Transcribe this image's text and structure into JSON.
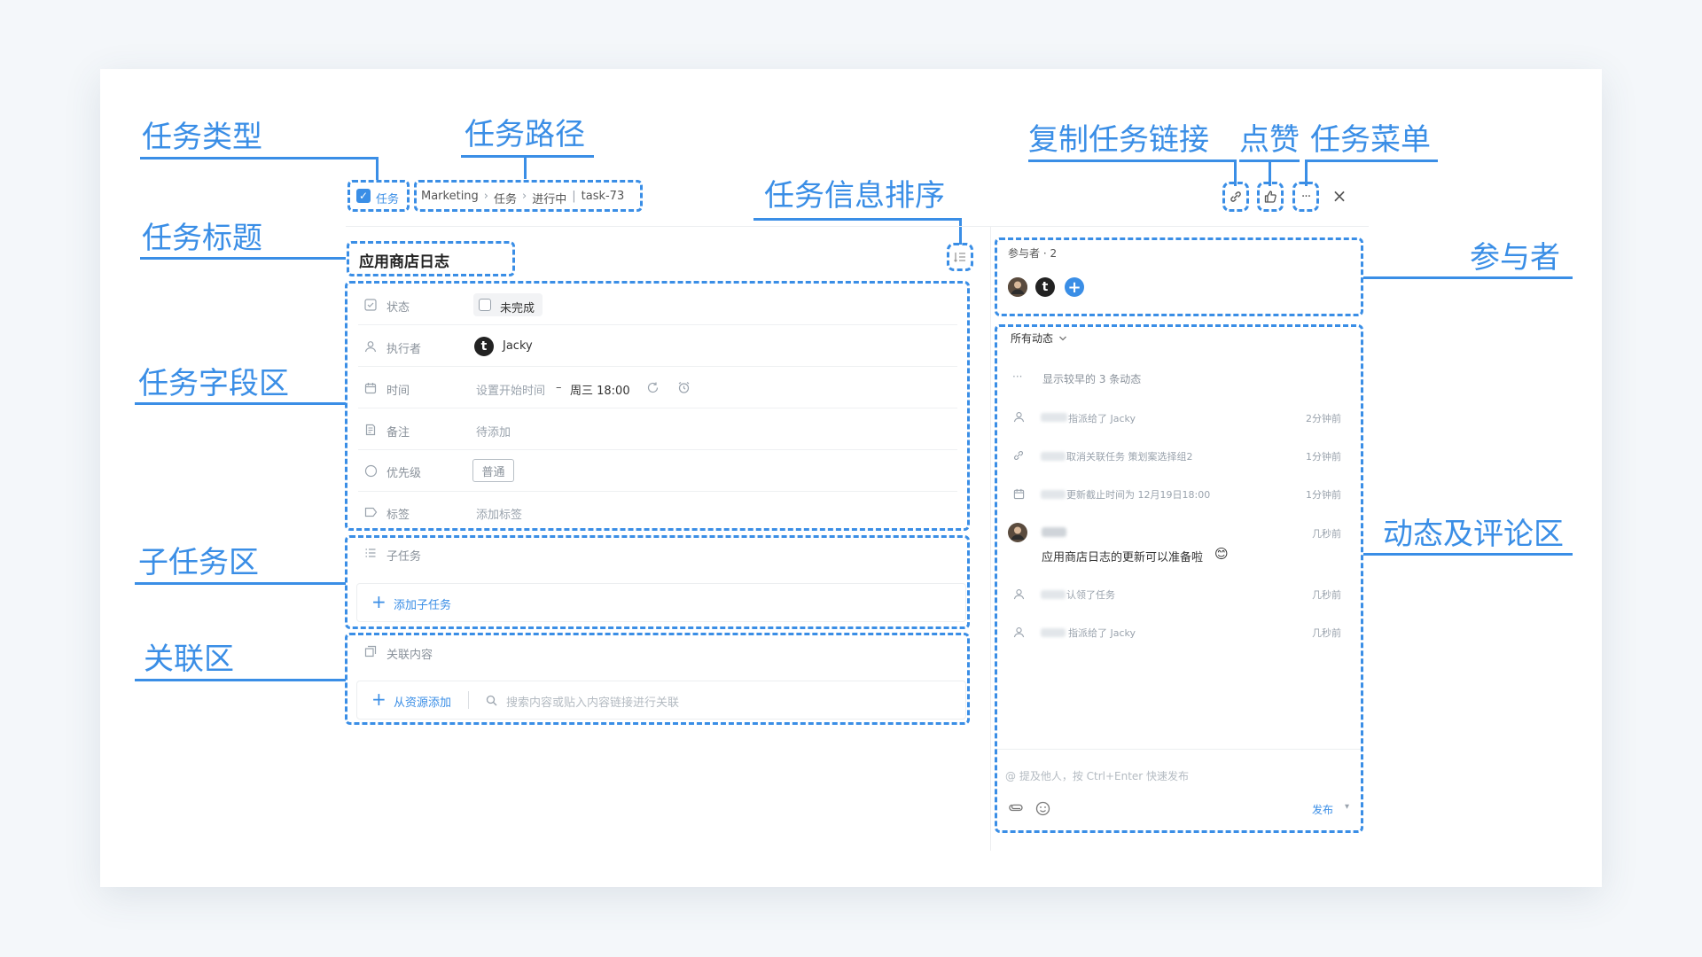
{
  "annotations": {
    "task_type": "任务类型",
    "task_path": "任务路径",
    "task_title": "任务标题",
    "task_info_sort": "任务信息排序",
    "copy_link": "复制任务链接",
    "like": "点赞",
    "task_menu": "任务菜单",
    "participants": "参与者",
    "fields_area": "任务字段区",
    "subtasks_area": "子任务区",
    "relations_area": "关联区",
    "activity_area": "动态及评论区"
  },
  "header": {
    "task_type_label": "任务",
    "breadcrumb": [
      "Marketing",
      "任务",
      "进行中",
      "task-73"
    ],
    "close_symbol": "×"
  },
  "task": {
    "title": "应用商店日志"
  },
  "fields": {
    "status": {
      "label": "状态",
      "value": "未完成"
    },
    "assignee": {
      "label": "执行者",
      "value": "Jacky",
      "avatar_letter": "t"
    },
    "time": {
      "label": "时间",
      "start_placeholder": "设置开始时间",
      "separator": "–",
      "end": "周三 18:00"
    },
    "note": {
      "label": "备注",
      "placeholder": "待添加"
    },
    "priority": {
      "label": "优先级",
      "value": "普通"
    },
    "tags": {
      "label": "标签",
      "placeholder": "添加标签"
    }
  },
  "subtasks": {
    "header": "子任务",
    "add_label": "添加子任务"
  },
  "relations": {
    "header": "关联内容",
    "add_label": "从资源添加",
    "search_placeholder": "搜索内容或贴入内容链接进行关联"
  },
  "participants": {
    "header": "参与者 · 2",
    "avatar_letter": "t",
    "add_symbol": "+"
  },
  "activity": {
    "filter_label": "所有动态",
    "more_symbol": "···",
    "show_earlier": "显示较早的 3 条动态",
    "items": [
      {
        "type": "user",
        "text": "指派给了 Jacky",
        "time": "2分钟前"
      },
      {
        "type": "link",
        "text": "取消关联任务 策划案选择组2",
        "time": "1分钟前"
      },
      {
        "type": "calendar",
        "text": "更新截止时间为 12月19日18:00",
        "time": "1分钟前"
      },
      {
        "type": "comment",
        "text": "应用商店日志的更新可以准备啦",
        "emoji": "😊",
        "time": "几秒前"
      },
      {
        "type": "user",
        "text": "认领了任务",
        "time": "几秒前"
      },
      {
        "type": "user",
        "text": "指派给了 Jacky",
        "time": "几秒前"
      }
    ],
    "comment_placeholder": "@ 提及他人，按 Ctrl+Enter 快速发布",
    "publish_label": "发布",
    "publish_caret": "▾"
  },
  "colors": {
    "annotation": "#3a8ee6",
    "accent": "#3a8ee6"
  }
}
